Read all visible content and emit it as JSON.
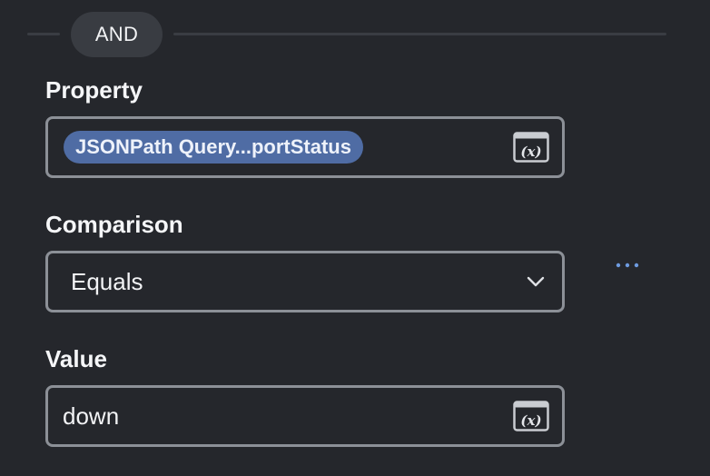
{
  "logic": {
    "operator_label": "AND"
  },
  "property": {
    "label": "Property",
    "token_label": "JSONPath Query...portStatus",
    "insert_variable_icon": "variable-x-icon"
  },
  "comparison": {
    "label": "Comparison",
    "selected": "Equals",
    "dropdown_icon": "chevron-down-icon",
    "more_icon": "ellipsis-icon"
  },
  "value": {
    "label": "Value",
    "input_value": "down",
    "insert_variable_icon": "variable-x-icon"
  },
  "colors": {
    "background": "#25272c",
    "border": "#8c9097",
    "chip": "#4f6ca4",
    "pill": "#393c42",
    "accent_dots": "#6e9be0"
  }
}
